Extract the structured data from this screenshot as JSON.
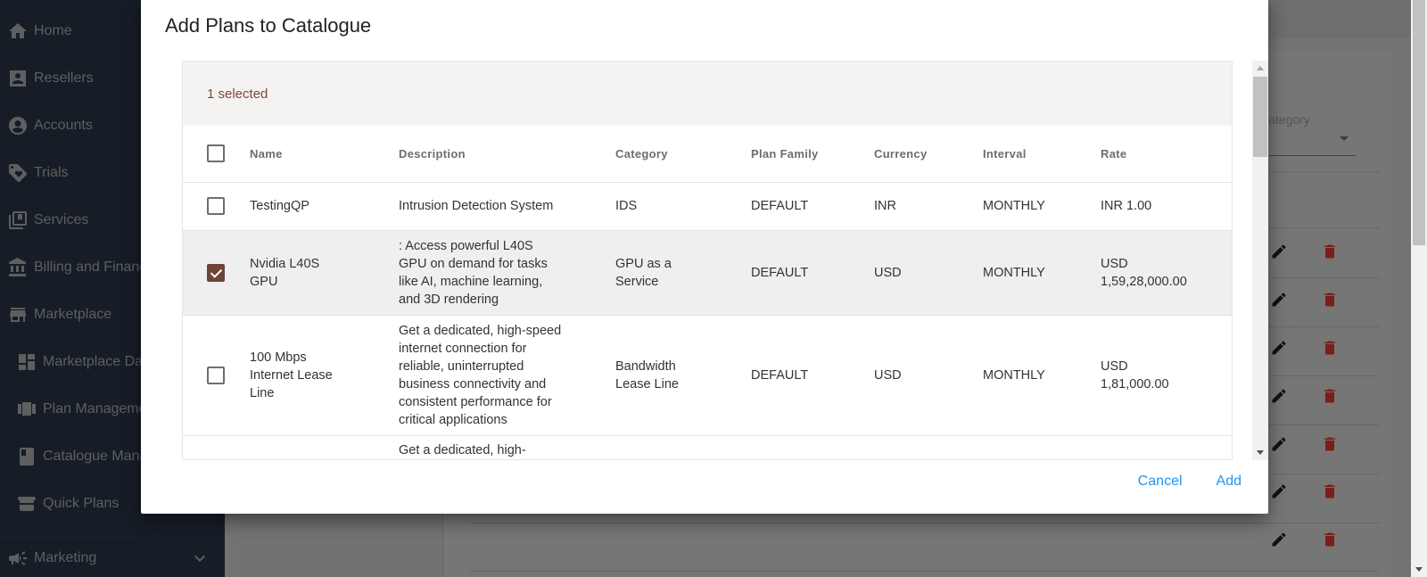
{
  "sidebar": {
    "items": [
      {
        "label": "Home",
        "icon": "home-icon"
      },
      {
        "label": "Resellers",
        "icon": "contact-card-icon"
      },
      {
        "label": "Accounts",
        "icon": "account-circle-icon"
      },
      {
        "label": "Trials",
        "icon": "tag-heart-icon"
      },
      {
        "label": "Services",
        "icon": "library-bookmark-icon"
      },
      {
        "label": "Billing and Finance",
        "icon": "bank-icon"
      },
      {
        "label": "Marketplace",
        "icon": "store-icon"
      },
      {
        "label": "Marketplace Dashboard",
        "icon": "dashboard-icon"
      },
      {
        "label": "Plan Management",
        "icon": "carousel-icon"
      },
      {
        "label": "Catalogue Management",
        "icon": "book-icon"
      },
      {
        "label": "Quick Plans",
        "icon": "stacked-bars-icon"
      },
      {
        "label": "Marketing",
        "icon": "megaphone-icon"
      }
    ]
  },
  "background": {
    "category_label": "Category"
  },
  "modal": {
    "title": "Add Plans to Catalogue",
    "selected_text": "1 selected",
    "columns": [
      "Name",
      "Description",
      "Category",
      "Plan Family",
      "Currency",
      "Interval",
      "Rate"
    ],
    "rows": [
      {
        "checked": false,
        "name": "TestingQP",
        "description": "Intrusion Detection System",
        "category": "IDS",
        "plan_family": "DEFAULT",
        "currency": "INR",
        "interval": "MONTHLY",
        "rate": "INR 1.00"
      },
      {
        "checked": true,
        "name": "Nvidia L40S GPU",
        "description": ": Access powerful L40S GPU on demand for tasks like AI, machine learning, and 3D rendering",
        "category": "GPU as a Service",
        "plan_family": "DEFAULT",
        "currency": "USD",
        "interval": "MONTHLY",
        "rate": "USD 1,59,28,000.00"
      },
      {
        "checked": false,
        "name": "100 Mbps Internet Lease Line",
        "description": "Get a dedicated, high-speed internet connection for reliable, uninterrupted business connectivity and consistent performance for critical applications",
        "category": "Bandwidth Lease Line",
        "plan_family": "DEFAULT",
        "currency": "USD",
        "interval": "MONTHLY",
        "rate": "USD 1,81,000.00"
      },
      {
        "checked": false,
        "name": "",
        "description": "Get a dedicated, high-",
        "category": "",
        "plan_family": "",
        "currency": "",
        "interval": "",
        "rate": ""
      }
    ],
    "cancel_label": "Cancel",
    "add_label": "Add"
  }
}
